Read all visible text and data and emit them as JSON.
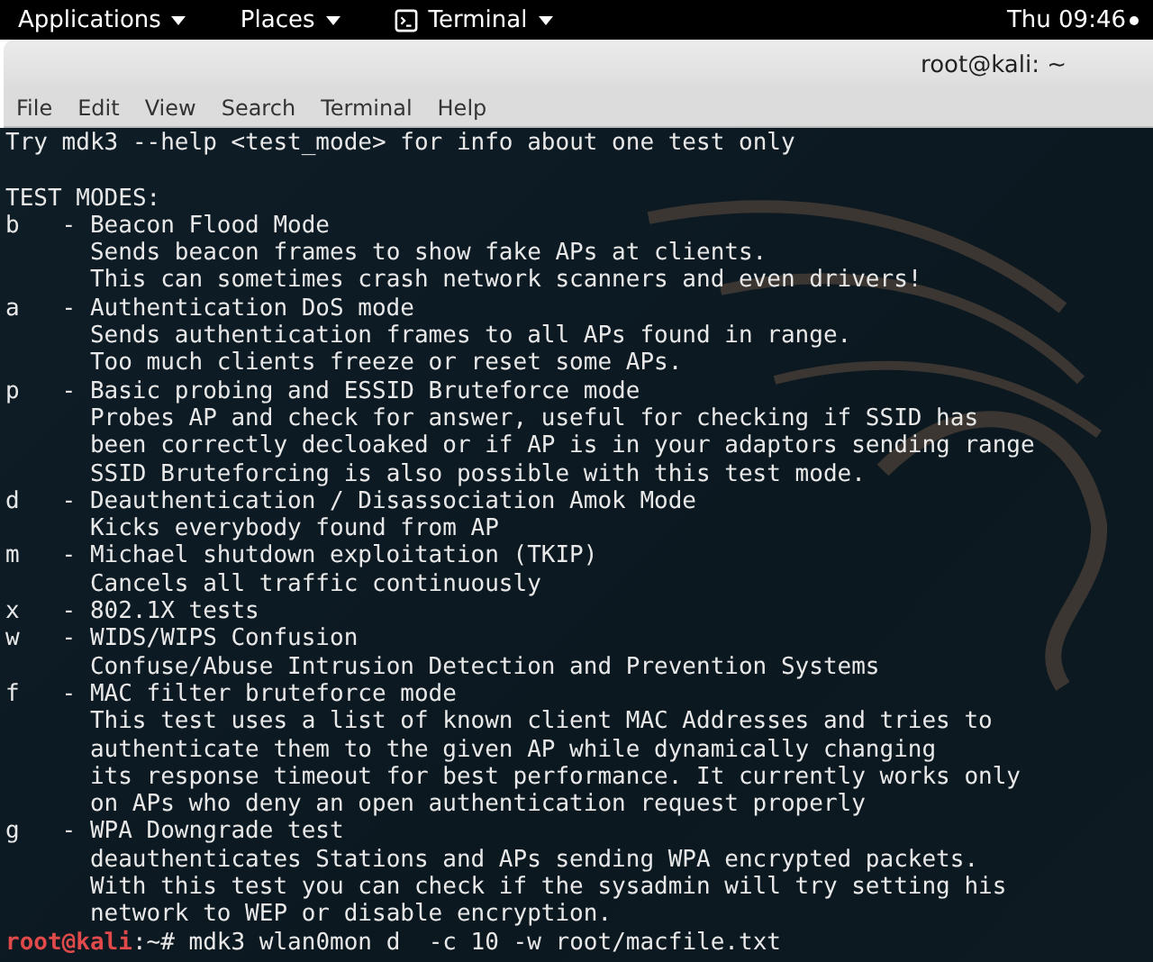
{
  "top_bar": {
    "menus": [
      {
        "label": "Applications",
        "icon": false
      },
      {
        "label": "Places",
        "icon": false
      },
      {
        "label": "Terminal",
        "icon": true
      }
    ],
    "clock": "Thu 09:46"
  },
  "window": {
    "title": "root@kali: ~",
    "menu": [
      "File",
      "Edit",
      "View",
      "Search",
      "Terminal",
      "Help"
    ]
  },
  "terminal": {
    "intro": "Try mdk3 --help <test_mode> for info about one test only",
    "heading": "TEST MODES:",
    "modes": [
      {
        "key": "b",
        "title": "- Beacon Flood Mode",
        "description": [
          "Sends beacon frames to show fake APs at clients.",
          "This can sometimes crash network scanners and even drivers!"
        ]
      },
      {
        "key": "a",
        "title": "- Authentication DoS mode",
        "description": [
          "Sends authentication frames to all APs found in range.",
          "Too much clients freeze or reset some APs."
        ]
      },
      {
        "key": "p",
        "title": "- Basic probing and ESSID Bruteforce mode",
        "description": [
          "Probes AP and check for answer, useful for checking if SSID has",
          "been correctly decloaked or if AP is in your adaptors sending range",
          "SSID Bruteforcing is also possible with this test mode."
        ]
      },
      {
        "key": "d",
        "title": "- Deauthentication / Disassociation Amok Mode",
        "description": [
          "Kicks everybody found from AP"
        ]
      },
      {
        "key": "m",
        "title": "- Michael shutdown exploitation (TKIP)",
        "description": [
          "Cancels all traffic continuously"
        ]
      },
      {
        "key": "x",
        "title": "- 802.1X tests"
      },
      {
        "key": "w",
        "title": "- WIDS/WIPS Confusion",
        "description": [
          "Confuse/Abuse Intrusion Detection and Prevention Systems"
        ]
      },
      {
        "key": "f",
        "title": "- MAC filter bruteforce mode",
        "description": [
          "This test uses a list of known client MAC Addresses and tries to",
          "authenticate them to the given AP while dynamically changing",
          "its response timeout for best performance. It currently works only",
          "on APs who deny an open authentication request properly"
        ]
      },
      {
        "key": "g",
        "title": "- WPA Downgrade test",
        "description": [
          "deauthenticates Stations and APs sending WPA encrypted packets.",
          "With this test you can check if the sysadmin will try setting his",
          "network to WEP or disable encryption."
        ]
      }
    ],
    "prompt": {
      "user_host": "root@kali",
      "suffix": ":~#",
      "command": "mdk3 wlan0mon d  -c 10 -w root/macfile.txt"
    }
  }
}
